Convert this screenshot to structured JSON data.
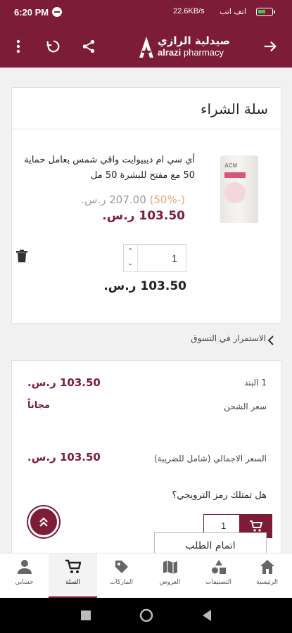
{
  "status_bar": {
    "time": "6:20 PM",
    "network_speed": "22.6KB/s",
    "carrier": "اتف اتب"
  },
  "header": {
    "logo_ar": "صيدلية الرازي",
    "logo_en_brand": "alrazi",
    "logo_en_suffix": " pharmacy",
    "icons": [
      "menu-dots-icon",
      "refresh-icon",
      "share-icon",
      "forward-arrow-icon"
    ]
  },
  "cart": {
    "title": "سلة الشراء",
    "item": {
      "name": "أي سي ام ديبيوايت واقي شمس بعامل حماية 50 مع مفتح للبشرة 50 مل",
      "image_text": "ACM",
      "old_price": "207.00 ر.س.",
      "discount": "(-50%)",
      "new_price": "103.50 ر.س.",
      "quantity": "1",
      "line_total": "103.50 ر.س."
    },
    "continue_shopping": "الاستمرار في التسوق"
  },
  "summary": {
    "items_label": "1 البند",
    "items_value": "103.50 ر.س.",
    "shipping_label": "سعر الشحن",
    "shipping_value": "مجاناً",
    "total_label": "السعر الاجمالي (شامل للضريبة)",
    "total_value": "103.50 ر.س.",
    "promo_question": "هل تمتلك رمز الترويجي؟",
    "promo_value": "1",
    "checkout_label": "اتمام الطلب"
  },
  "bottom_nav": {
    "items": [
      {
        "label": "حسابي",
        "icon": "account-icon"
      },
      {
        "label": "السلة",
        "icon": "cart-icon",
        "active": true
      },
      {
        "label": "الماركات",
        "icon": "tag-icon"
      },
      {
        "label": "العروض",
        "icon": "map-icon"
      },
      {
        "label": "التصنيفات",
        "icon": "categories-icon"
      },
      {
        "label": "الرئيسية",
        "icon": "home-icon"
      }
    ]
  },
  "colors": {
    "brand": "#7c1c37",
    "discount": "#e8a46c"
  }
}
